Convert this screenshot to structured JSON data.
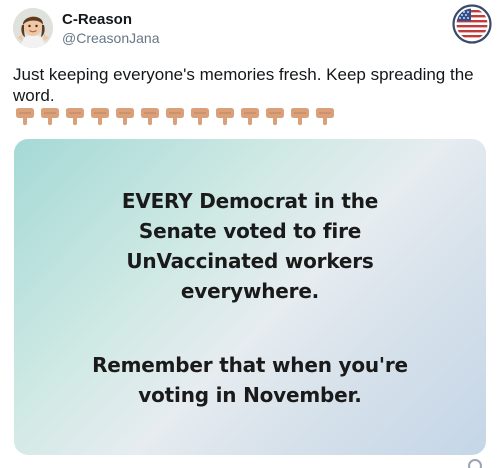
{
  "tweet": {
    "author": {
      "display_name": "C-Reason",
      "handle": "@CreasonJana",
      "avatar_icon": "memoji-avatar-icon",
      "badge_icon": "us-flag-circle-icon"
    },
    "text": "Just keeping everyone's memories fresh. Keep spreading the word.",
    "emoji": {
      "icon": "pointing-down-hand-icon",
      "count": 13,
      "color": "#d9a07a"
    },
    "image_card": {
      "paragraph_1": [
        "EVERY Democrat in the",
        "Senate voted to fire",
        "UnVaccinated workers",
        "everywhere."
      ],
      "paragraph_2": [
        "Remember that when you're",
        "voting in November."
      ]
    }
  }
}
